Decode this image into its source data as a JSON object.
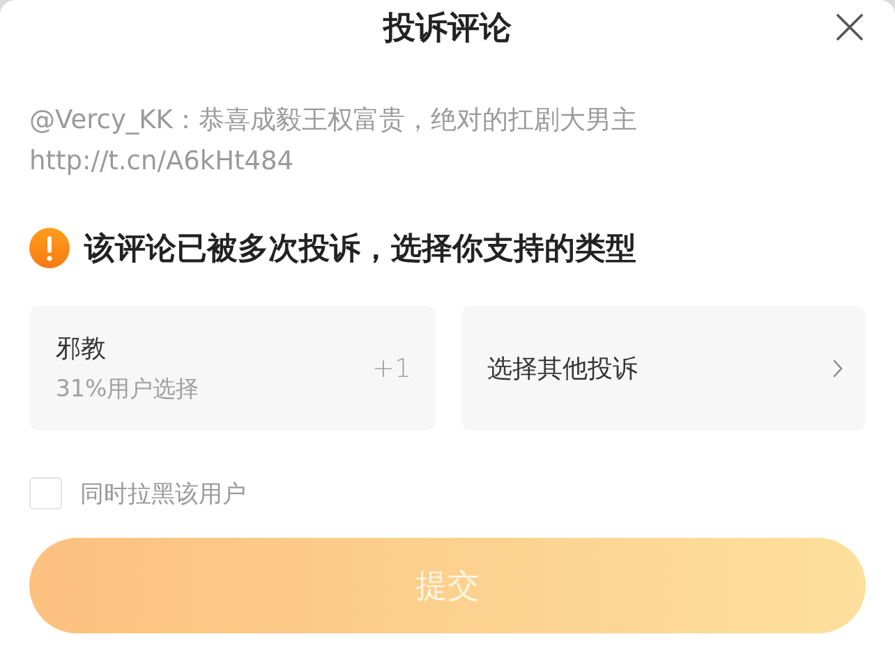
{
  "dialog": {
    "title": "投诉评论"
  },
  "comment": {
    "text": "@Vercy_KK：恭喜成毅王权富贵，绝对的扛剧大男主",
    "url": "http://t.cn/A6kHt484"
  },
  "notice": {
    "text": "该评论已被多次投诉，选择你支持的类型"
  },
  "options": [
    {
      "kind": "vote",
      "label": "邪教",
      "share": "31%用户选择",
      "action": "+1",
      "selected": false
    },
    {
      "kind": "more",
      "label": "选择其他投诉",
      "selected": false
    }
  ],
  "block_user": {
    "label": "同时拉黑该用户",
    "checked": false
  },
  "submit": {
    "label": "提交",
    "disabled": true
  }
}
